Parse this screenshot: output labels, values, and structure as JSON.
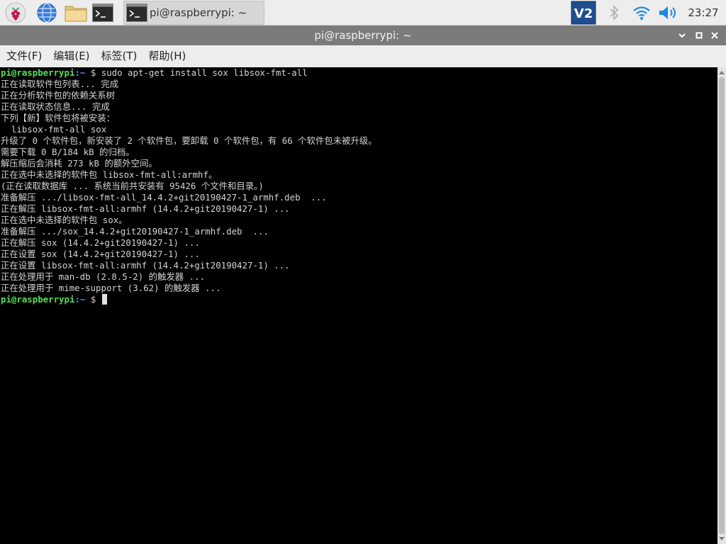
{
  "panel": {
    "launchers": [
      {
        "name": "raspberry-menu",
        "icon": "raspberry-icon"
      },
      {
        "name": "web-browser",
        "icon": "globe-icon"
      },
      {
        "name": "file-manager",
        "icon": "folder-icon"
      },
      {
        "name": "terminal",
        "icon": "terminal-icon"
      }
    ],
    "task": {
      "label": "pi@raspberrypi: ~",
      "icon": "terminal-icon"
    },
    "tray": {
      "vnc_icon": "vnc-icon",
      "bluetooth_icon": "bluetooth-icon",
      "wifi_icon": "wifi-icon",
      "volume_icon": "volume-icon",
      "clock": "23:27"
    }
  },
  "window": {
    "title": "pi@raspberrypi: ~",
    "buttons": [
      "chevron-down-icon",
      "maximize-icon",
      "close-icon"
    ]
  },
  "menu": {
    "file": "文件(F)",
    "edit": "编辑(E)",
    "tabs": "标签(T)",
    "help": "帮助(H)"
  },
  "terminal": {
    "prompt_user": "pi@raspberrypi",
    "prompt_dir": ":~",
    "prompt_sign": " $ ",
    "command": "sudo apt-get install sox libsox-fmt-all",
    "output": [
      "正在读取软件包列表... 完成",
      "正在分析软件包的依赖关系树",
      "正在读取状态信息... 完成",
      "下列【新】软件包将被安装：",
      "  libsox-fmt-all sox",
      "升级了 0 个软件包，新安装了 2 个软件包，要卸载 0 个软件包，有 66 个软件包未被升级。",
      "需要下载 0 B/184 kB 的归档。",
      "解压缩后会消耗 273 kB 的额外空间。",
      "正在选中未选择的软件包 libsox-fmt-all:armhf。",
      "(正在读取数据库 ... 系统当前共安装有 95426 个文件和目录。)",
      "准备解压 .../libsox-fmt-all_14.4.2+git20190427-1_armhf.deb  ...",
      "正在解压 libsox-fmt-all:armhf (14.4.2+git20190427-1) ...",
      "正在选中未选择的软件包 sox。",
      "准备解压 .../sox_14.4.2+git20190427-1_armhf.deb  ...",
      "正在解压 sox (14.4.2+git20190427-1) ...",
      "正在设置 sox (14.4.2+git20190427-1) ...",
      "正在设置 libsox-fmt-all:armhf (14.4.2+git20190427-1) ...",
      "正在处理用于 man-db (2.8.5-2) 的触发器 ...",
      "正在处理用于 mime-support (3.62) 的触发器 ..."
    ]
  },
  "colors": {
    "prompt_user": "#55e055",
    "prompt_dir": "#5c8cff",
    "terminal_bg": "#000000",
    "terminal_fg": "#d3d3d3",
    "titlebar_bg": "#7b7b7b",
    "panel_bg": "#ededed",
    "vnc_blue": "#1f4e8c"
  }
}
